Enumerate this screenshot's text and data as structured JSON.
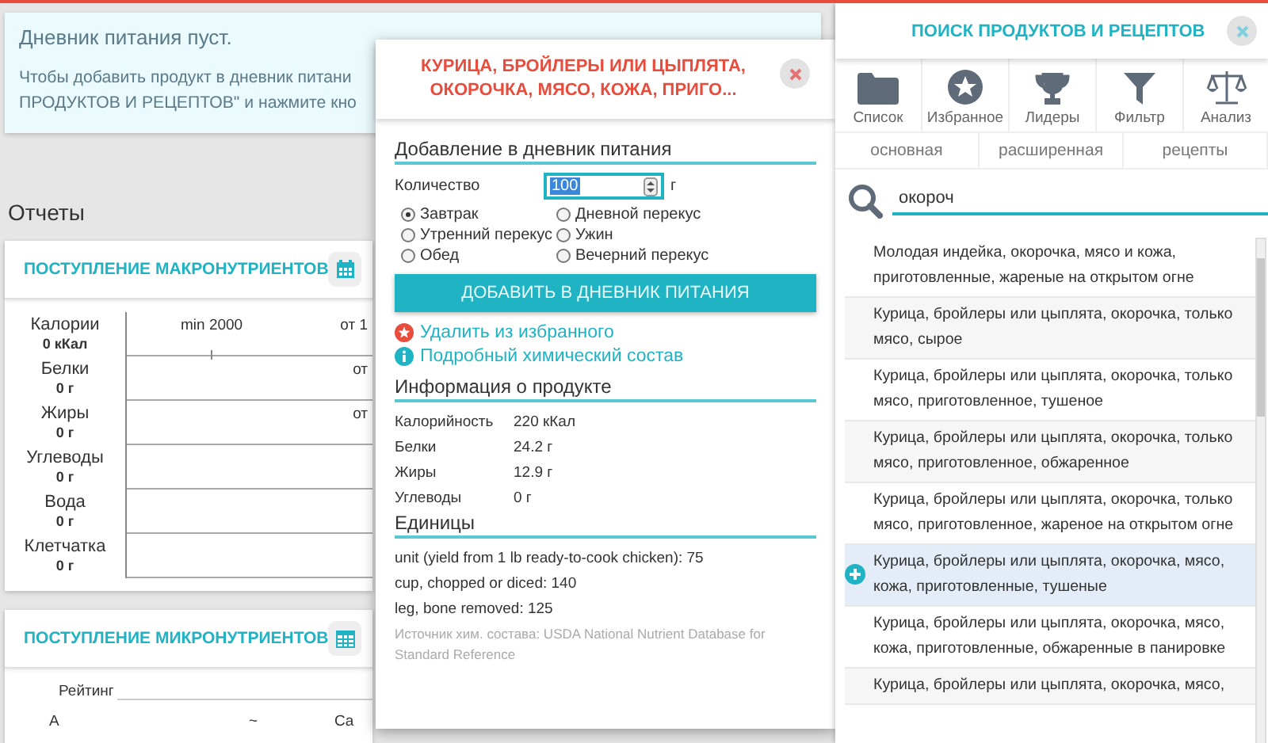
{
  "info": {
    "title": "Дневник питания пуст.",
    "lines": [
      "Чтобы добавить продукт в дневник питани",
      "ПРОДУКТОВ И РЕЦЕПТОВ\" и нажмите кно"
    ]
  },
  "reports_title": "Отчеты",
  "macro": {
    "title": "ПОСТУПЛЕНИЕ МАКРОНУТРИЕНТОВ",
    "min_label": "min 2000",
    "rows": [
      {
        "label": "Калории",
        "value": "0 кКал",
        "marker": "от 1"
      },
      {
        "label": "Белки",
        "value": "0 г",
        "marker": "от"
      },
      {
        "label": "Жиры",
        "value": "0 г",
        "marker": "от"
      },
      {
        "label": "Углеводы",
        "value": "0 г"
      },
      {
        "label": "Вода",
        "value": "0 г"
      },
      {
        "label": "Клетчатка",
        "value": "0 г"
      }
    ]
  },
  "micro": {
    "title": "ПОСТУПЛЕНИЕ МИКРОНУТРИЕНТОВ",
    "rating_label": "Рейтинг",
    "row": [
      "A",
      "~",
      "Ca"
    ]
  },
  "dialog": {
    "title": "КУРИЦА, БРОЙЛЕРЫ ИЛИ ЦЫПЛЯТА, ОКОРОЧКА, МЯСО, КОЖА, ПРИГО...",
    "add_section": "Добавление в дневник питания",
    "quantity_label": "Количество",
    "quantity_value": "100",
    "unit": "г",
    "meals": [
      {
        "label": "Завтрак",
        "selected": true
      },
      {
        "label": "Дневной перекус",
        "selected": false
      },
      {
        "label": "Утренний перекус",
        "selected": false
      },
      {
        "label": "Ужин",
        "selected": false
      },
      {
        "label": "Обед",
        "selected": false
      },
      {
        "label": "Вечерний перекус",
        "selected": false
      }
    ],
    "add_button": "ДОБАВИТЬ В ДНЕВНИК ПИТАНИЯ",
    "links": [
      {
        "kind": "favorite",
        "label": "Удалить из избранного"
      },
      {
        "kind": "info",
        "label": "Подробный химический состав"
      }
    ],
    "info_title": "Информация о продукте",
    "info_rows": [
      {
        "label": "Калорийность",
        "value": "220 кКал"
      },
      {
        "label": "Белки",
        "value": "24.2 г"
      },
      {
        "label": "Жиры",
        "value": "12.9 г"
      },
      {
        "label": "Углеводы",
        "value": "0 г"
      }
    ],
    "units_title": "Единицы",
    "units": [
      "unit (yield from 1 lb ready-to-cook chicken): 75",
      "cup, chopped or diced: 140",
      "leg, bone removed: 125"
    ],
    "source": "Источник хим. состава: USDA National Nutrient Database for Standard Reference"
  },
  "search_panel": {
    "title": "ПОИСК ПРОДУКТОВ И РЕЦЕПТОВ",
    "tools": [
      {
        "kind": "folder",
        "label": "Список"
      },
      {
        "kind": "star",
        "label": "Избранное"
      },
      {
        "kind": "trophy",
        "label": "Лидеры"
      },
      {
        "kind": "filter",
        "label": "Фильтр"
      },
      {
        "kind": "scales",
        "label": "Анализ"
      }
    ],
    "tabs": [
      "основная",
      "расширенная",
      "рецепты"
    ],
    "query": "окороч",
    "results": [
      {
        "text": "Молодая индейка, окорочка, мясо и кожа, приготовленные, жареные на открытом огне",
        "selected": false
      },
      {
        "text": "Курица, бройлеры или цыплята, окорочка, только мясо, сырое",
        "selected": false
      },
      {
        "text": "Курица, бройлеры или цыплята, окорочка, только мясо, приготовленное, тушеное",
        "selected": false
      },
      {
        "text": "Курица, бройлеры или цыплята, окорочка, только мясо, приготовленное, обжаренное",
        "selected": false
      },
      {
        "text": "Курица, бройлеры или цыплята, окорочка, только мясо, приготовленное, жареное на открытом огне",
        "selected": false
      },
      {
        "text": "Курица, бройлеры или цыплята, окорочка, мясо, кожа, приготовленные, тушеные",
        "selected": true
      },
      {
        "text": "Курица, бройлеры или цыплята, окорочка, мясо, кожа, приготовленные, обжаренные в панировке",
        "selected": false
      },
      {
        "text": "Курица, бройлеры или цыплята, окорочка, мясо,",
        "selected": false
      }
    ]
  }
}
